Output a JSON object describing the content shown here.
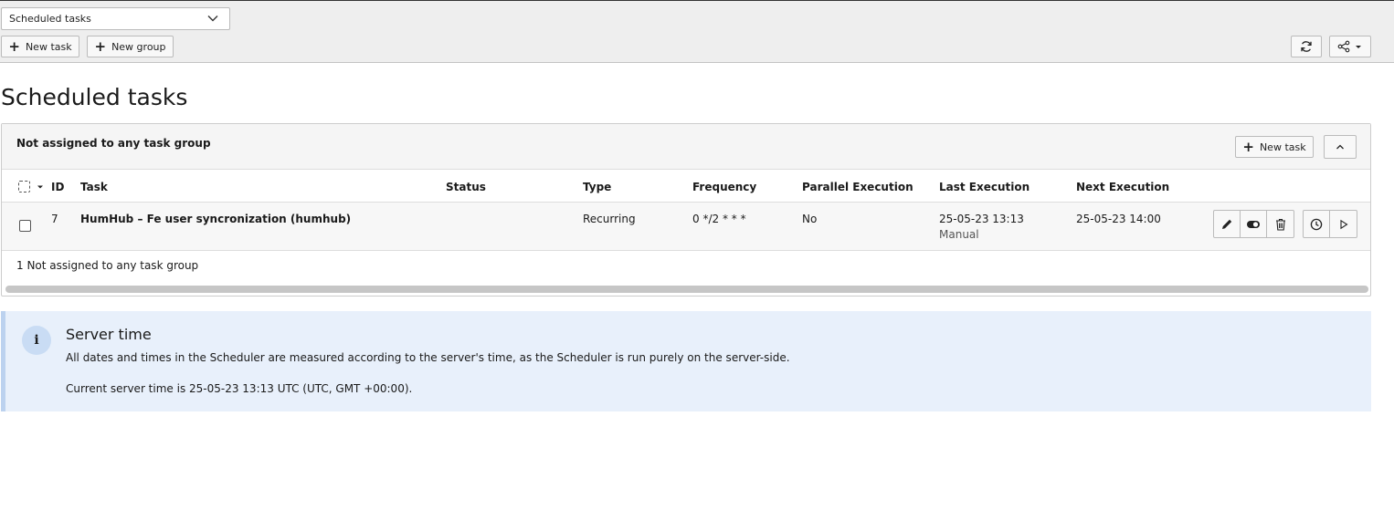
{
  "topbar": {
    "module_select": "Scheduled tasks",
    "new_task_label": "New task",
    "new_group_label": "New group"
  },
  "page": {
    "title": "Scheduled tasks"
  },
  "panel": {
    "title": "Not assigned to any task group",
    "new_task_label": "New task",
    "columns": {
      "id": "ID",
      "task": "Task",
      "status": "Status",
      "type": "Type",
      "frequency": "Frequency",
      "parallel": "Parallel Execution",
      "last": "Last Execution",
      "next": "Next Execution"
    },
    "rows": [
      {
        "id": "7",
        "task": "HumHub – Fe user syncronization (humhub)",
        "status": "",
        "type": "Recurring",
        "frequency": "0 */2 * * *",
        "parallel": "No",
        "last": "25-05-23 13:13",
        "last_sub": "Manual",
        "next": "25-05-23 14:00"
      }
    ],
    "footer": "1 Not assigned to any task group"
  },
  "info": {
    "icon": "i",
    "title": "Server time",
    "line1": "All dates and times in the Scheduler are measured according to the server's time, as the Scheduler is run purely on the server-side.",
    "line2": "Current server time is 25-05-23 13:13 UTC (UTC, GMT +00:00)."
  },
  "icons": {
    "chevron": "chevron-down-icon",
    "plus": "plus-icon",
    "refresh": "refresh-icon",
    "share": "share-icon",
    "collapse": "chevron-up-icon",
    "edit": "pencil-icon",
    "toggle": "toggle-icon",
    "delete": "trash-icon",
    "schedule": "clock-icon",
    "run": "play-icon"
  },
  "colors": {
    "topbar_bg": "#eeeeee",
    "info_bg": "#e8f0fb",
    "info_border": "#bcd2ef",
    "row_bg": "#f7f7f7"
  }
}
